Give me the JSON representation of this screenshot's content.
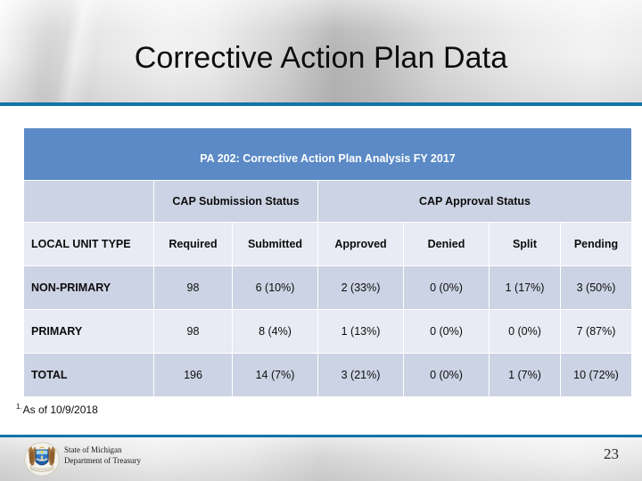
{
  "slide": {
    "title": "Corrective Action Plan Data",
    "page_number": "23",
    "accent_color": "#1274a7",
    "table_header_color": "#5b8ac6",
    "row_dark_color": "#ccd3e4",
    "row_light_color": "#e8ebf4"
  },
  "table": {
    "caption": "PA 202: Corrective Action Plan Analysis FY 2017",
    "group_headers": [
      {
        "label": "",
        "span": 1
      },
      {
        "label": "CAP Submission Status",
        "span": 2
      },
      {
        "label": "CAP Approval Status",
        "span": 4
      }
    ],
    "columns": [
      "LOCAL UNIT TYPE",
      "Required",
      "Submitted",
      "Approved",
      "Denied",
      "Split",
      "Pending"
    ],
    "rows": [
      {
        "label": "NON-PRIMARY",
        "required": "98",
        "submitted": "6 (10%)",
        "approved": "2 (33%)",
        "denied": "0 (0%)",
        "split": "1 (17%)",
        "pending": "3 (50%)"
      },
      {
        "label": "PRIMARY",
        "required": "98",
        "submitted": "8 (4%)",
        "approved": "1 (13%)",
        "denied": "0 (0%)",
        "split": "0 (0%)",
        "pending": "7 (87%)"
      },
      {
        "label": "TOTAL",
        "required": "196",
        "submitted": "14 (7%)",
        "approved": "3 (21%)",
        "denied": "0 (0%)",
        "split": "1 (7%)",
        "pending": "10 (72%)"
      }
    ]
  },
  "footnote": {
    "marker": "1.",
    "text": "As of 10/9/2018"
  },
  "footer": {
    "org_line1": "State of Michigan",
    "org_line2": "Department of Treasury",
    "seal_icon": "michigan-state-seal-icon"
  }
}
